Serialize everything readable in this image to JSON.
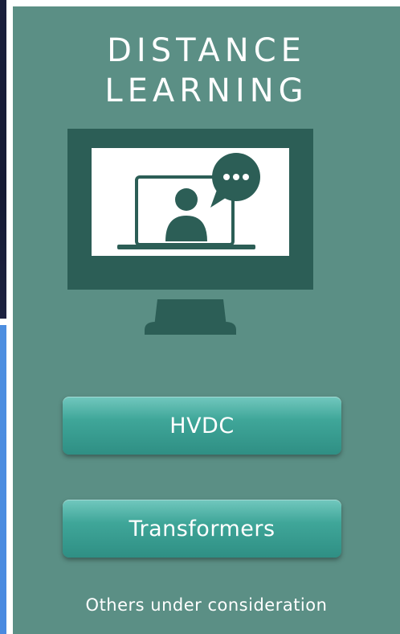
{
  "panel": {
    "title_line1": "DISTANCE",
    "title_line2": "LEARNING",
    "icon": "monitor-video-chat-icon",
    "buttons": [
      {
        "label": "HVDC"
      },
      {
        "label": "Transformers"
      }
    ],
    "footer": "Others under consideration"
  },
  "colors": {
    "panel_bg": "#5b8f85",
    "monitor": "#2c5e56",
    "button_top": "#72c8be",
    "button_bottom": "#2f8f84",
    "left_dark": "#1a1f3c",
    "left_blue": "#4d8ee0"
  }
}
